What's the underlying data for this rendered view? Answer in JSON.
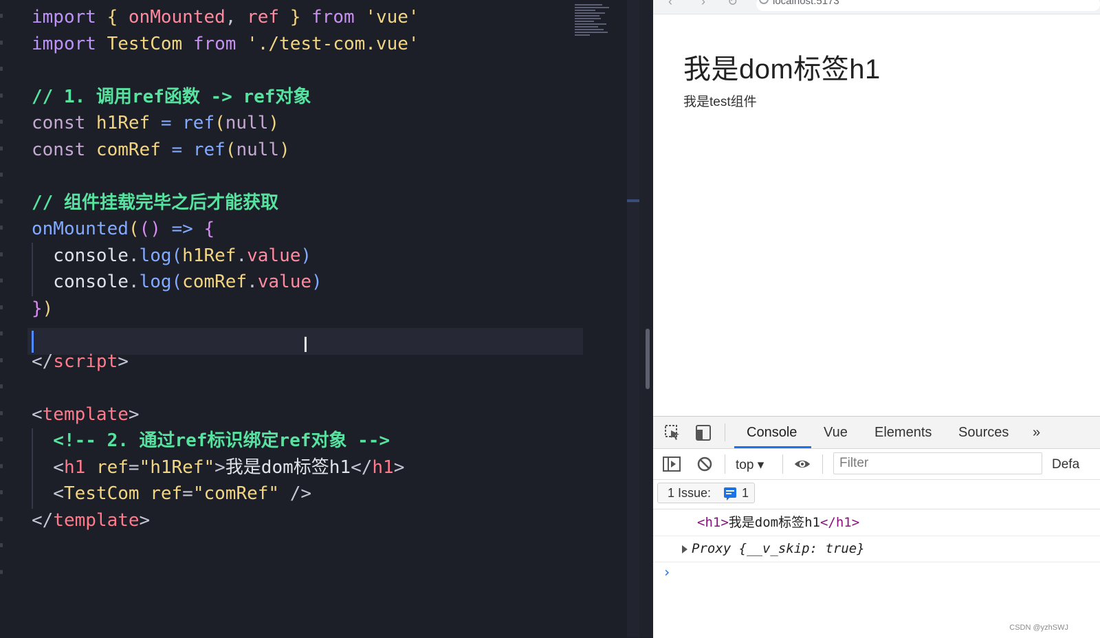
{
  "editor": {
    "lines": [
      {
        "tokens": [
          [
            "imp",
            "import"
          ],
          [
            "brace1",
            " { "
          ],
          [
            "var",
            "onMounted"
          ],
          [
            "punc",
            ", "
          ],
          [
            "var",
            "ref"
          ],
          [
            "brace1",
            " } "
          ],
          [
            "from",
            "from "
          ],
          [
            "str",
            "'vue'"
          ]
        ]
      },
      {
        "tokens": [
          [
            "imp",
            "import "
          ],
          [
            "id",
            "TestCom "
          ],
          [
            "from",
            "from "
          ],
          [
            "str",
            "'./test-com.vue'"
          ]
        ]
      },
      {
        "tokens": []
      },
      {
        "tokens": [
          [
            "cmt",
            "// 1. 调用ref函数 -> ref对象"
          ]
        ]
      },
      {
        "tokens": [
          [
            "kw",
            "const "
          ],
          [
            "id",
            "h1Ref "
          ],
          [
            "fn",
            "= "
          ],
          [
            "fn",
            "ref"
          ],
          [
            "brace1",
            "("
          ],
          [
            "kw",
            "null"
          ],
          [
            "brace1",
            ")"
          ]
        ]
      },
      {
        "tokens": [
          [
            "kw",
            "const "
          ],
          [
            "id",
            "comRef "
          ],
          [
            "fn",
            "= "
          ],
          [
            "fn",
            "ref"
          ],
          [
            "brace1",
            "("
          ],
          [
            "kw",
            "null"
          ],
          [
            "brace1",
            ")"
          ]
        ]
      },
      {
        "tokens": []
      },
      {
        "tokens": [
          [
            "cmt",
            "// 组件挂载完毕之后才能获取"
          ]
        ]
      },
      {
        "tokens": [
          [
            "fn",
            "onMounted"
          ],
          [
            "brace1",
            "("
          ],
          [
            "brace2",
            "() "
          ],
          [
            "fn",
            "=> "
          ],
          [
            "brace2",
            "{"
          ]
        ]
      },
      {
        "tokens": [
          [
            "plain",
            "  console"
          ],
          [
            "punc",
            "."
          ],
          [
            "fn",
            "log"
          ],
          [
            "brace3",
            "("
          ],
          [
            "id",
            "h1Ref"
          ],
          [
            "punc",
            "."
          ],
          [
            "var",
            "value"
          ],
          [
            "brace3",
            ")"
          ]
        ]
      },
      {
        "tokens": [
          [
            "plain",
            "  console"
          ],
          [
            "punc",
            "."
          ],
          [
            "fn",
            "log"
          ],
          [
            "brace3",
            "("
          ],
          [
            "id",
            "comRef"
          ],
          [
            "punc",
            "."
          ],
          [
            "var",
            "value"
          ],
          [
            "brace3",
            ")"
          ]
        ]
      },
      {
        "tokens": [
          [
            "brace2",
            "}"
          ],
          [
            "brace1",
            ")"
          ]
        ]
      },
      {
        "tokens": []
      },
      {
        "tokens": [
          [
            "punc",
            "</"
          ],
          [
            "tag",
            "script"
          ],
          [
            "punc",
            ">"
          ]
        ]
      },
      {
        "tokens": []
      },
      {
        "tokens": [
          [
            "punc",
            "<"
          ],
          [
            "tag",
            "template"
          ],
          [
            "punc",
            ">"
          ]
        ]
      },
      {
        "tokens": [
          [
            "cmt",
            "  <!-- 2. 通过ref标识绑定ref对象 -->"
          ]
        ]
      },
      {
        "tokens": [
          [
            "punc",
            "  <"
          ],
          [
            "tag",
            "h1 "
          ],
          [
            "attr",
            "ref"
          ],
          [
            "punc",
            "="
          ],
          [
            "str",
            "\"h1Ref\""
          ],
          [
            "punc",
            ">"
          ],
          [
            "plain",
            "我是dom标签h1"
          ],
          [
            "punc",
            "</"
          ],
          [
            "tag",
            "h1"
          ],
          [
            "punc",
            ">"
          ]
        ]
      },
      {
        "tokens": [
          [
            "punc",
            "  <"
          ],
          [
            "id",
            "TestCom "
          ],
          [
            "attr",
            "ref"
          ],
          [
            "punc",
            "="
          ],
          [
            "str",
            "\"comRef\""
          ],
          [
            "punc",
            " />"
          ]
        ]
      },
      {
        "tokens": [
          [
            "punc",
            "</"
          ],
          [
            "tag",
            "template"
          ],
          [
            "punc",
            ">"
          ]
        ]
      }
    ]
  },
  "browser": {
    "address": "localhost:5173",
    "page_heading": "我是dom标签h1",
    "page_text": "我是test组件"
  },
  "devtools": {
    "tabs": [
      "Console",
      "Vue",
      "Elements",
      "Sources"
    ],
    "more_tabs": "»",
    "context": "top ▾",
    "filter_placeholder": "Filter",
    "levels": "Defa",
    "issues_label": "1 Issue:",
    "issues_count": "1",
    "console": {
      "row1_open": "<h1>",
      "row1_text": "我是dom标签h1",
      "row1_close": "</h1>",
      "row2": "Proxy {__v_skip: true}",
      "prompt": "›"
    }
  },
  "watermark": "CSDN @yzhSWJ",
  "colors": {
    "accent": "#1a73e8",
    "editor_bg": "#1d1f28"
  }
}
